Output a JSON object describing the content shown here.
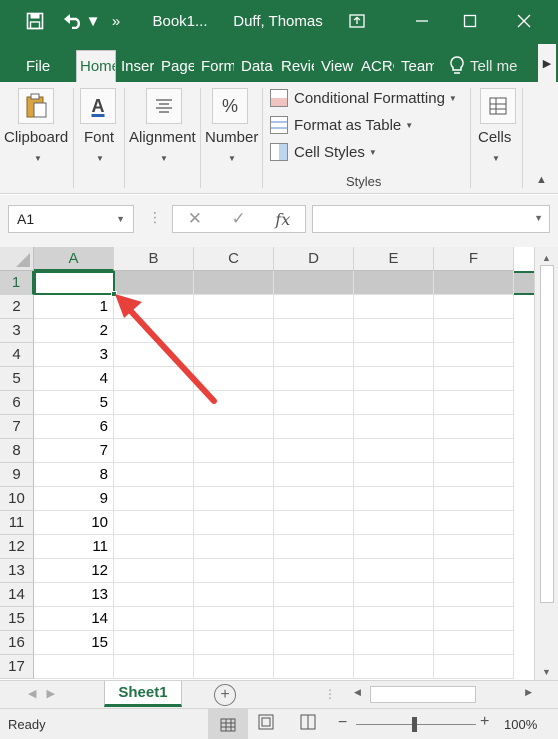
{
  "titlebar": {
    "doc_title": "Book1...",
    "user_name": "Duff, Thomas",
    "save_icon": "save-icon",
    "undo_icon": "undo-icon"
  },
  "tabs": {
    "file": "File",
    "home": "Home",
    "insert": "Insert",
    "page_layout": "Page Layout",
    "formulas": "Formulas",
    "data": "Data",
    "review": "Review",
    "view": "View",
    "acrobat": "ACROBAT",
    "team": "Team",
    "tell_me": "Tell me"
  },
  "ribbon": {
    "clipboard": "Clipboard",
    "font": "Font",
    "alignment": "Alignment",
    "number": "Number",
    "conditional_formatting": "Conditional Formatting",
    "format_as_table": "Format as Table",
    "cell_styles": "Cell Styles",
    "styles_group": "Styles",
    "cells": "Cells",
    "number_icon_glyph": "%",
    "font_icon_glyph": "A"
  },
  "formula_bar": {
    "name_box": "A1",
    "fx_label": "fx",
    "formula_value": ""
  },
  "grid": {
    "columns": [
      "A",
      "B",
      "C",
      "D",
      "E",
      "F"
    ],
    "rows": [
      "1",
      "2",
      "3",
      "4",
      "5",
      "6",
      "7",
      "8",
      "9",
      "10",
      "11",
      "12",
      "13",
      "14",
      "15",
      "16",
      "17"
    ],
    "column_a_values": [
      "",
      "1",
      "2",
      "3",
      "4",
      "5",
      "6",
      "7",
      "8",
      "9",
      "10",
      "11",
      "12",
      "13",
      "14",
      "15",
      ""
    ],
    "selected_cell": "A1",
    "accent_color": "#217346"
  },
  "sheets": {
    "active_tab": "Sheet1"
  },
  "statusbar": {
    "status": "Ready",
    "zoom": "100%"
  },
  "annotation": {
    "arrow_color": "#e8403a"
  }
}
